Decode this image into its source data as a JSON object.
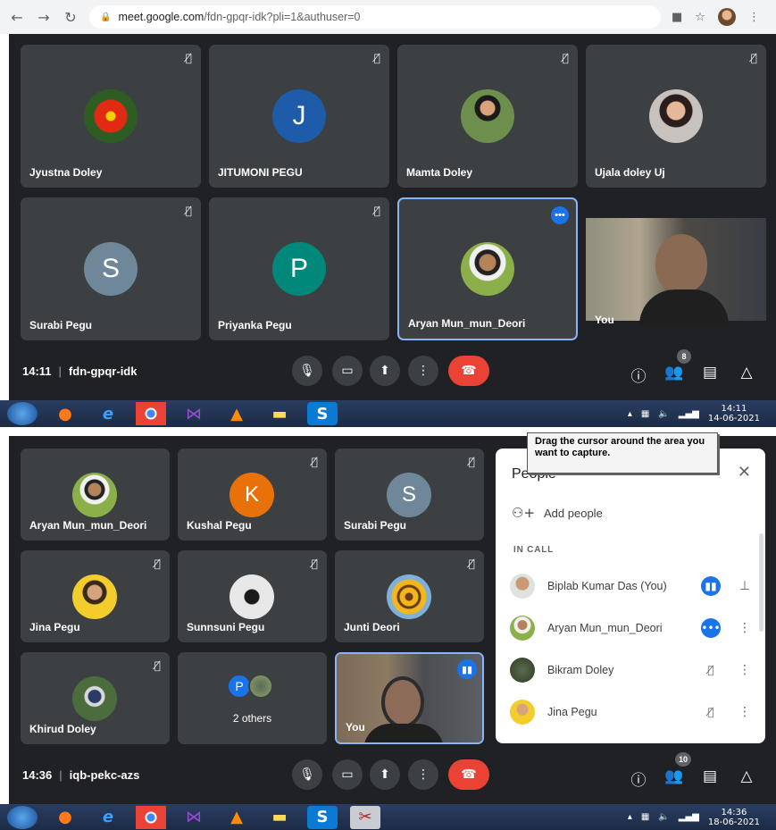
{
  "browser": {
    "url_host": "meet.google.com",
    "url_path": "/fdn-gpqr-idk?pli=1&authuser=0"
  },
  "screen1": {
    "tiles": [
      {
        "name": "Jyustna Doley"
      },
      {
        "name": "JITUMONI PEGU",
        "initial": "J"
      },
      {
        "name": "Mamta Doley"
      },
      {
        "name": "Ujala doley Uj"
      },
      {
        "name": "Surabi Pegu",
        "initial": "S"
      },
      {
        "name": "Priyanka Pegu",
        "initial": "P"
      },
      {
        "name": "Aryan Mun_mun_Deori"
      },
      {
        "name": "You"
      }
    ],
    "time": "14:11",
    "meeting_code": "fdn-gpqr-idk",
    "people_count": "8",
    "clock_time": "14:11",
    "clock_date": "14-06-2021"
  },
  "screen2": {
    "tiles": [
      {
        "name": "Aryan Mun_mun_Deori"
      },
      {
        "name": "Kushal Pegu",
        "initial": "K"
      },
      {
        "name": "Surabi Pegu",
        "initial": "S"
      },
      {
        "name": "Jina Pegu"
      },
      {
        "name": "Sunnsuni Pegu"
      },
      {
        "name": "Junti Deori"
      },
      {
        "name": "Khirud Doley"
      },
      {
        "name": "2 others",
        "initial": "P"
      },
      {
        "name": "You"
      }
    ],
    "time": "14:36",
    "meeting_code": "iqb-pekc-azs",
    "people_count": "10",
    "clock_time": "14:36",
    "clock_date": "18-06-2021"
  },
  "people_panel": {
    "title": "People",
    "add_people": "Add people",
    "section": "IN CALL",
    "participants": [
      {
        "name": "Biplab Kumar Das (You)"
      },
      {
        "name": "Aryan Mun_mun_Deori"
      },
      {
        "name": "Bikram Doley"
      },
      {
        "name": "Jina Pegu"
      }
    ]
  },
  "tooltip": {
    "text": "Drag the cursor around the area you want to capture."
  },
  "colors": {
    "meet_bg": "#202124",
    "tile_bg": "#3c4043",
    "end_call": "#ea4335",
    "accent": "#1a73e8",
    "avatar_j": "#1e5ba8",
    "avatar_s": "#6e8899",
    "avatar_p": "#00897b",
    "avatar_k": "#e8710a"
  }
}
